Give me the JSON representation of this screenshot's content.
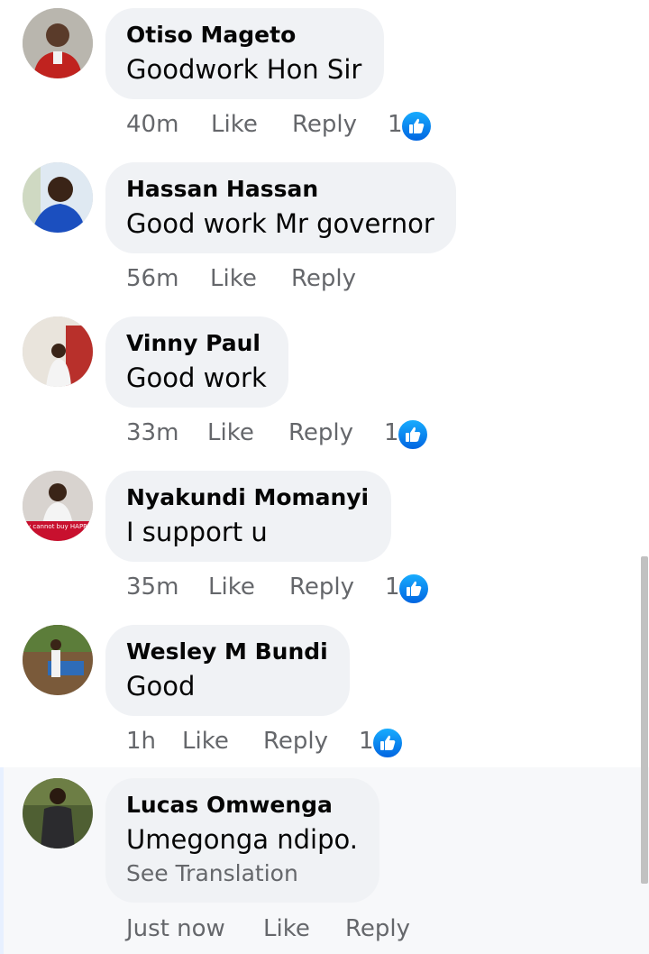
{
  "comments": [
    {
      "author": "Otiso Mageto",
      "text": "Goodwork Hon Sir",
      "time": "40m",
      "like": "Like",
      "reply": "Reply",
      "reactions": "1"
    },
    {
      "author": "Hassan Hassan",
      "text": "Good work Mr governor",
      "time": "56m",
      "like": "Like",
      "reply": "Reply",
      "reactions": ""
    },
    {
      "author": "Vinny Paul",
      "text": "Good work",
      "time": "33m",
      "like": "Like",
      "reply": "Reply",
      "reactions": "1"
    },
    {
      "author": "Nyakundi Momanyi",
      "text": "I support u",
      "time": "35m",
      "like": "Like",
      "reply": "Reply",
      "reactions": "1",
      "avatar_caption": "Money cannot buy HAPPINESS"
    },
    {
      "author": "Wesley M Bundi",
      "text": "Good",
      "time": "1h",
      "like": "Like",
      "reply": "Reply",
      "reactions": "1"
    },
    {
      "author": "Lucas Omwenga",
      "text": "Umegonga ndipo.",
      "translation": "See Translation",
      "time": "Just now",
      "like": "Like",
      "reply": "Reply",
      "reactions": ""
    }
  ],
  "colors": {
    "bubble": "#f0f2f5",
    "meta_text": "#65676b",
    "like_blue": "#1877f2"
  },
  "icons": {
    "reaction": "like-thumb-icon"
  }
}
